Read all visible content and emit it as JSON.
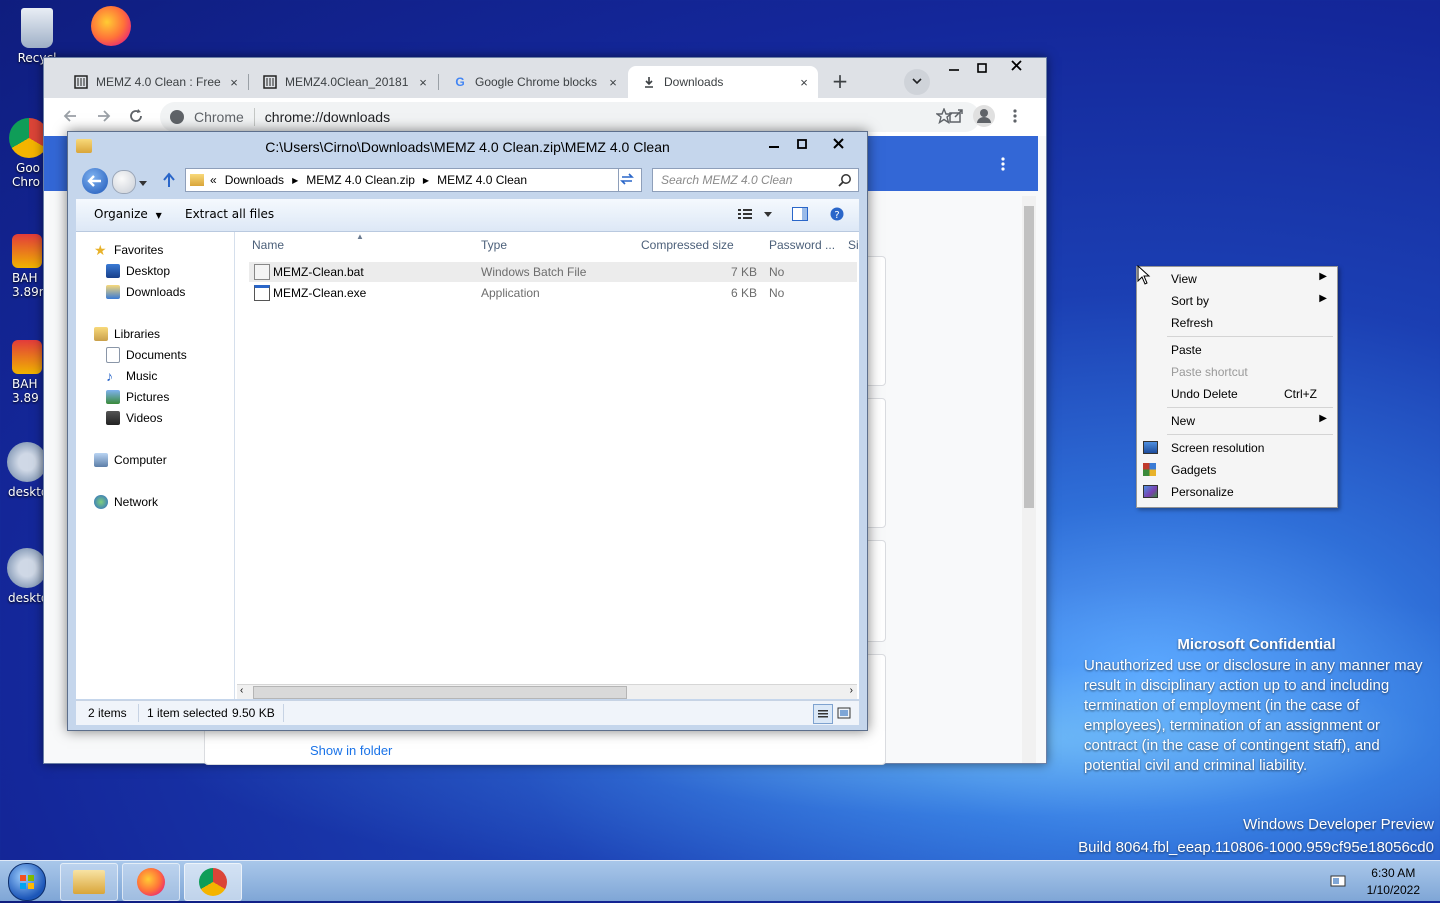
{
  "desktop": {
    "icons": [
      {
        "label": "Recycl",
        "icon": "recycle-bin-icon"
      },
      {
        "label": "",
        "icon": "firefox-icon"
      },
      {
        "label": "Goo",
        "label2": "Chro",
        "icon": "chrome-icon"
      },
      {
        "label": "BAH",
        "label2": "3.89r",
        "icon": "tool-icon"
      },
      {
        "label": "BAH",
        "label2": "3.89",
        "icon": "tool-icon"
      },
      {
        "label": "deskto",
        "icon": "gear-icon"
      },
      {
        "label": "deskto",
        "icon": "gear-icon"
      }
    ],
    "watermark": {
      "heading": "Microsoft Confidential",
      "body": "Unauthorized use or disclosure in any manner may result in disciplinary action up to and including termination of employment (in the case of employees), termination of an assignment or contract (in the case of contingent staff), and potential civil and criminal liability.",
      "build_line1": "Windows Developer Preview",
      "build_line2": "Build 8064.fbl_eeap.110806-1000.959cf95e18056cd0"
    }
  },
  "taskbar": {
    "time": "6:30 AM",
    "date": "1/10/2022"
  },
  "chrome": {
    "tabs": [
      {
        "title": "MEMZ 4.0 Clean : Free",
        "close": "×"
      },
      {
        "title": "MEMZ4.0Clean_20181",
        "close": "×"
      },
      {
        "title": "Google Chrome blocks",
        "close": "×"
      },
      {
        "title": "Downloads",
        "close": "×"
      }
    ],
    "new_tab": "+",
    "site_label": "Chrome",
    "url": "chrome://downloads",
    "show_in_folder": "Show in folder"
  },
  "explorer": {
    "title": "C:\\Users\\Cirno\\Downloads\\MEMZ 4.0 Clean.zip\\MEMZ 4.0 Clean",
    "breadcrumb": [
      "«",
      "Downloads",
      "MEMZ 4.0 Clean.zip",
      "MEMZ 4.0 Clean"
    ],
    "search_placeholder": "Search MEMZ 4.0 Clean",
    "commands": {
      "organize": "Organize",
      "extract": "Extract all files"
    },
    "nav": {
      "favorites": "Favorites",
      "desktop": "Desktop",
      "downloads": "Downloads",
      "libraries": "Libraries",
      "documents": "Documents",
      "music": "Music",
      "pictures": "Pictures",
      "videos": "Videos",
      "computer": "Computer",
      "network": "Network"
    },
    "columns": {
      "name": "Name",
      "type": "Type",
      "compressed": "Compressed size",
      "password": "Password ...",
      "size": "Si"
    },
    "files": [
      {
        "name": "MEMZ-Clean.bat",
        "type": "Windows Batch File",
        "compressed": "7 KB",
        "password": "No"
      },
      {
        "name": "MEMZ-Clean.exe",
        "type": "Application",
        "compressed": "6 KB",
        "password": "No"
      }
    ],
    "status": {
      "items": "2 items",
      "selected": "1 item selected",
      "size": "9.50 KB"
    }
  },
  "context_menu": {
    "items": [
      {
        "label": "View",
        "submenu": true
      },
      {
        "label": "Sort by",
        "submenu": true
      },
      {
        "label": "Refresh"
      },
      {
        "label": "Paste"
      },
      {
        "label": "Paste shortcut",
        "disabled": true
      },
      {
        "label": "Undo Delete",
        "shortcut": "Ctrl+Z"
      },
      {
        "label": "New",
        "submenu": true
      },
      {
        "label": "Screen resolution"
      },
      {
        "label": "Gadgets"
      },
      {
        "label": "Personalize"
      }
    ]
  }
}
